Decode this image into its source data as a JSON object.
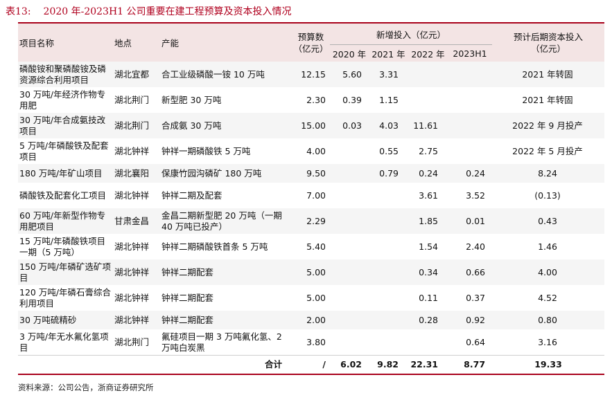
{
  "title": {
    "number": "表13:",
    "text": "2020 年-2023H1 公司重要在建工程预算及资本投入情况"
  },
  "headers": {
    "project": "项目名称",
    "location": "地点",
    "capacity": "产能",
    "budget": "预算数\n（亿元）",
    "new_investment": "新增投入（亿元）",
    "y2020": "2020 年",
    "y2021": "2021 年",
    "y2022": "2022 年",
    "y2023h1": "2023H1",
    "later": "预计后期资本投入\n（亿元）"
  },
  "rows": [
    {
      "project": "磷酸铵和聚磷酸铵及磷资源综合利用项目",
      "location": "湖北宜都",
      "capacity": "合工业级磷酸一铵 10 万吨",
      "budget": "12.15",
      "y2020": "5.60",
      "y2021": "3.31",
      "y2022": "",
      "y2023h1": "",
      "later": "2021 年转固"
    },
    {
      "project": "30 万吨/年经济作物专用肥",
      "location": "湖北荆门",
      "capacity": "新型肥 30 万吨",
      "budget": "2.30",
      "y2020": "0.39",
      "y2021": "1.15",
      "y2022": "",
      "y2023h1": "",
      "later": "2021 年转固"
    },
    {
      "project": "30 万吨/年合成氨技改项目",
      "location": "湖北荆门",
      "capacity": "合成氨 30 万吨",
      "budget": "15.00",
      "y2020": "0.03",
      "y2021": "4.03",
      "y2022": "11.61",
      "y2023h1": "",
      "later": "2022 年 9 月投产"
    },
    {
      "project": "5 万吨/年磷酸铁及配套项目",
      "location": "湖北钟祥",
      "capacity": "钟祥一期磷酸铁 5 万吨",
      "budget": "4.00",
      "y2020": "",
      "y2021": "0.55",
      "y2022": "2.75",
      "y2023h1": "",
      "later": "2022 年 5 月投产"
    },
    {
      "project": "180 万吨/年矿山项目",
      "location": "湖北襄阳",
      "capacity": "保康竹园沟磷矿 180 万吨",
      "budget": "9.50",
      "y2020": "",
      "y2021": "0.79",
      "y2022": "0.24",
      "y2023h1": "0.24",
      "later": "8.24"
    },
    {
      "project": "磷酸铁及配套化工项目",
      "location": "湖北钟祥",
      "capacity": "钟祥二期及配套",
      "budget": "7.00",
      "y2020": "",
      "y2021": "",
      "y2022": "3.61",
      "y2023h1": "3.52",
      "later": "(0.13)"
    },
    {
      "project": "60 万吨/年新型作物专用肥项目",
      "location": "甘肃金昌",
      "capacity": "金昌二期新型肥 20 万吨（一期 40 万吨已投产）",
      "budget": "2.29",
      "y2020": "",
      "y2021": "",
      "y2022": "1.85",
      "y2023h1": "0.01",
      "later": "0.43"
    },
    {
      "project": "15 万吨/年磷酸铁项目一期（5 万吨）",
      "location": "湖北钟祥",
      "capacity": "钟祥二期磷酸铁首条 5 万吨",
      "budget": "5.40",
      "y2020": "",
      "y2021": "",
      "y2022": "1.54",
      "y2023h1": "2.40",
      "later": "1.46"
    },
    {
      "project": "150 万吨/年磷矿选矿项目",
      "location": "湖北钟祥",
      "capacity": "钟祥二期配套",
      "budget": "5.00",
      "y2020": "",
      "y2021": "",
      "y2022": "0.34",
      "y2023h1": "0.66",
      "later": "4.00"
    },
    {
      "project": "120 万吨/年磷石膏综合利用项目",
      "location": "湖北钟祥",
      "capacity": "钟祥二期配套",
      "budget": "5.00",
      "y2020": "",
      "y2021": "",
      "y2022": "0.11",
      "y2023h1": "0.37",
      "later": "4.52"
    },
    {
      "project": "30 万吨硫精砂",
      "location": "湖北钟祥",
      "capacity": "钟祥二期配套",
      "budget": "2.00",
      "y2020": "",
      "y2021": "",
      "y2022": "0.28",
      "y2023h1": "0.92",
      "later": "0.80"
    },
    {
      "project": "3 万吨/年无水氟化氢项目",
      "location": "湖北荆门",
      "capacity": "氟硅项目一期 3 万吨氟化氢、2 万吨白炭黑",
      "budget": "3.80",
      "y2020": "",
      "y2021": "",
      "y2022": "",
      "y2023h1": "0.64",
      "later": "3.16"
    }
  ],
  "total": {
    "label": "合计",
    "budget": "/",
    "y2020": "6.02",
    "y2021": "9.82",
    "y2022": "22.31",
    "y2023h1": "8.77",
    "later": "19.33"
  },
  "source": "资料来源：公司公告，浙商证券研究所"
}
